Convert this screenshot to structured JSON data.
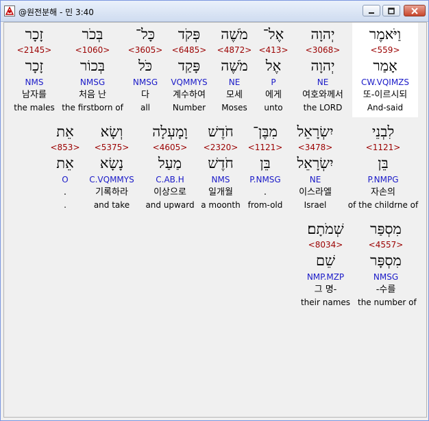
{
  "window": {
    "title": "@원전분해 - 민 3:40"
  },
  "icons": {
    "app": "compass-icon",
    "minimize": "minimize-icon",
    "maximize": "maximize-icon",
    "close": "close-icon"
  },
  "rows": [
    [
      {
        "heb": "וַיֹּאמֶר",
        "num": "<559>",
        "lemma": "אָמַר",
        "morph": "CW.VQIMZS",
        "kor": "또-이르시되",
        "eng": "And-said",
        "highlight": true
      },
      {
        "heb": "יְהוָה",
        "num": "<3068>",
        "lemma": "יְהוָה",
        "morph": "NE",
        "kor": "여호와께서",
        "eng": "the LORD"
      },
      {
        "heb": "אֶל־",
        "num": "<413>",
        "lemma": "אֶל",
        "morph": "P",
        "kor": "에게",
        "eng": "unto"
      },
      {
        "heb": "מֹשֶׁה",
        "num": "<4872>",
        "lemma": "מֹשֶׁה",
        "morph": "NE",
        "kor": "모세",
        "eng": "Moses"
      },
      {
        "heb": "פְּקֹד",
        "num": "<6485>",
        "lemma": "פָּקַד",
        "morph": "VQMMYS",
        "kor": "계수하여",
        "eng": "Number"
      },
      {
        "heb": "כָּל־",
        "num": "<3605>",
        "lemma": "כֹּל",
        "morph": "NMSG",
        "kor": "다",
        "eng": "all"
      },
      {
        "heb": "בְּכֹר",
        "num": "<1060>",
        "lemma": "בְּכוֹר",
        "morph": "NMSG",
        "kor": "처음 난",
        "eng": "the firstborn of"
      },
      {
        "heb": "זָכָר",
        "num": "<2145>",
        "lemma": "זָכָר",
        "morph": "NMS",
        "kor": "남자를",
        "eng": "the males"
      }
    ],
    [
      {
        "heb": "לִבְנֵי",
        "num": "<1121>",
        "lemma": "בֵּן",
        "morph": "P.NMPG",
        "kor": "자손의",
        "eng": "of the childrne of"
      },
      {
        "heb": "יִשְׂרָאֵל",
        "num": "<3478>",
        "lemma": "יִשְׂרָאֵל",
        "morph": "NE",
        "kor": "이스라엘",
        "eng": "Israel"
      },
      {
        "heb": "מִבֶּן־",
        "num": "<1121>",
        "lemma": "בֵּן",
        "morph": "P.NMSG",
        "kor": ".",
        "eng": "from-old"
      },
      {
        "heb": "חֹדֶשׁ",
        "num": "<2320>",
        "lemma": "חֹדֶשׁ",
        "morph": "NMS",
        "kor": "일개월",
        "eng": "a moonth"
      },
      {
        "heb": "וָמָעְלָה",
        "num": "<4605>",
        "lemma": "מַעַל",
        "morph": "C.AB.H",
        "kor": "이상으로",
        "eng": "and upward"
      },
      {
        "heb": "וְשָׂא",
        "num": "<5375>",
        "lemma": "נָשָׂא",
        "morph": "C.VQMMYS",
        "kor": "기록하라",
        "eng": "and take"
      },
      {
        "heb": "אֵת",
        "num": "<853>",
        "lemma": "אֵת",
        "morph": "O",
        "kor": ".",
        "eng": "."
      }
    ],
    [
      {
        "heb": "מִסְפַּר",
        "num": "<4557>",
        "lemma": "מִסְפָּר",
        "morph": "NMSG",
        "kor": "-수를",
        "eng": "the number of"
      },
      {
        "heb": "שְׁמֹתָם׃",
        "num": "<8034>",
        "lemma": "שֵׁם",
        "morph": "NMP.MZP",
        "kor": "그 명-",
        "eng": "their names"
      }
    ]
  ]
}
